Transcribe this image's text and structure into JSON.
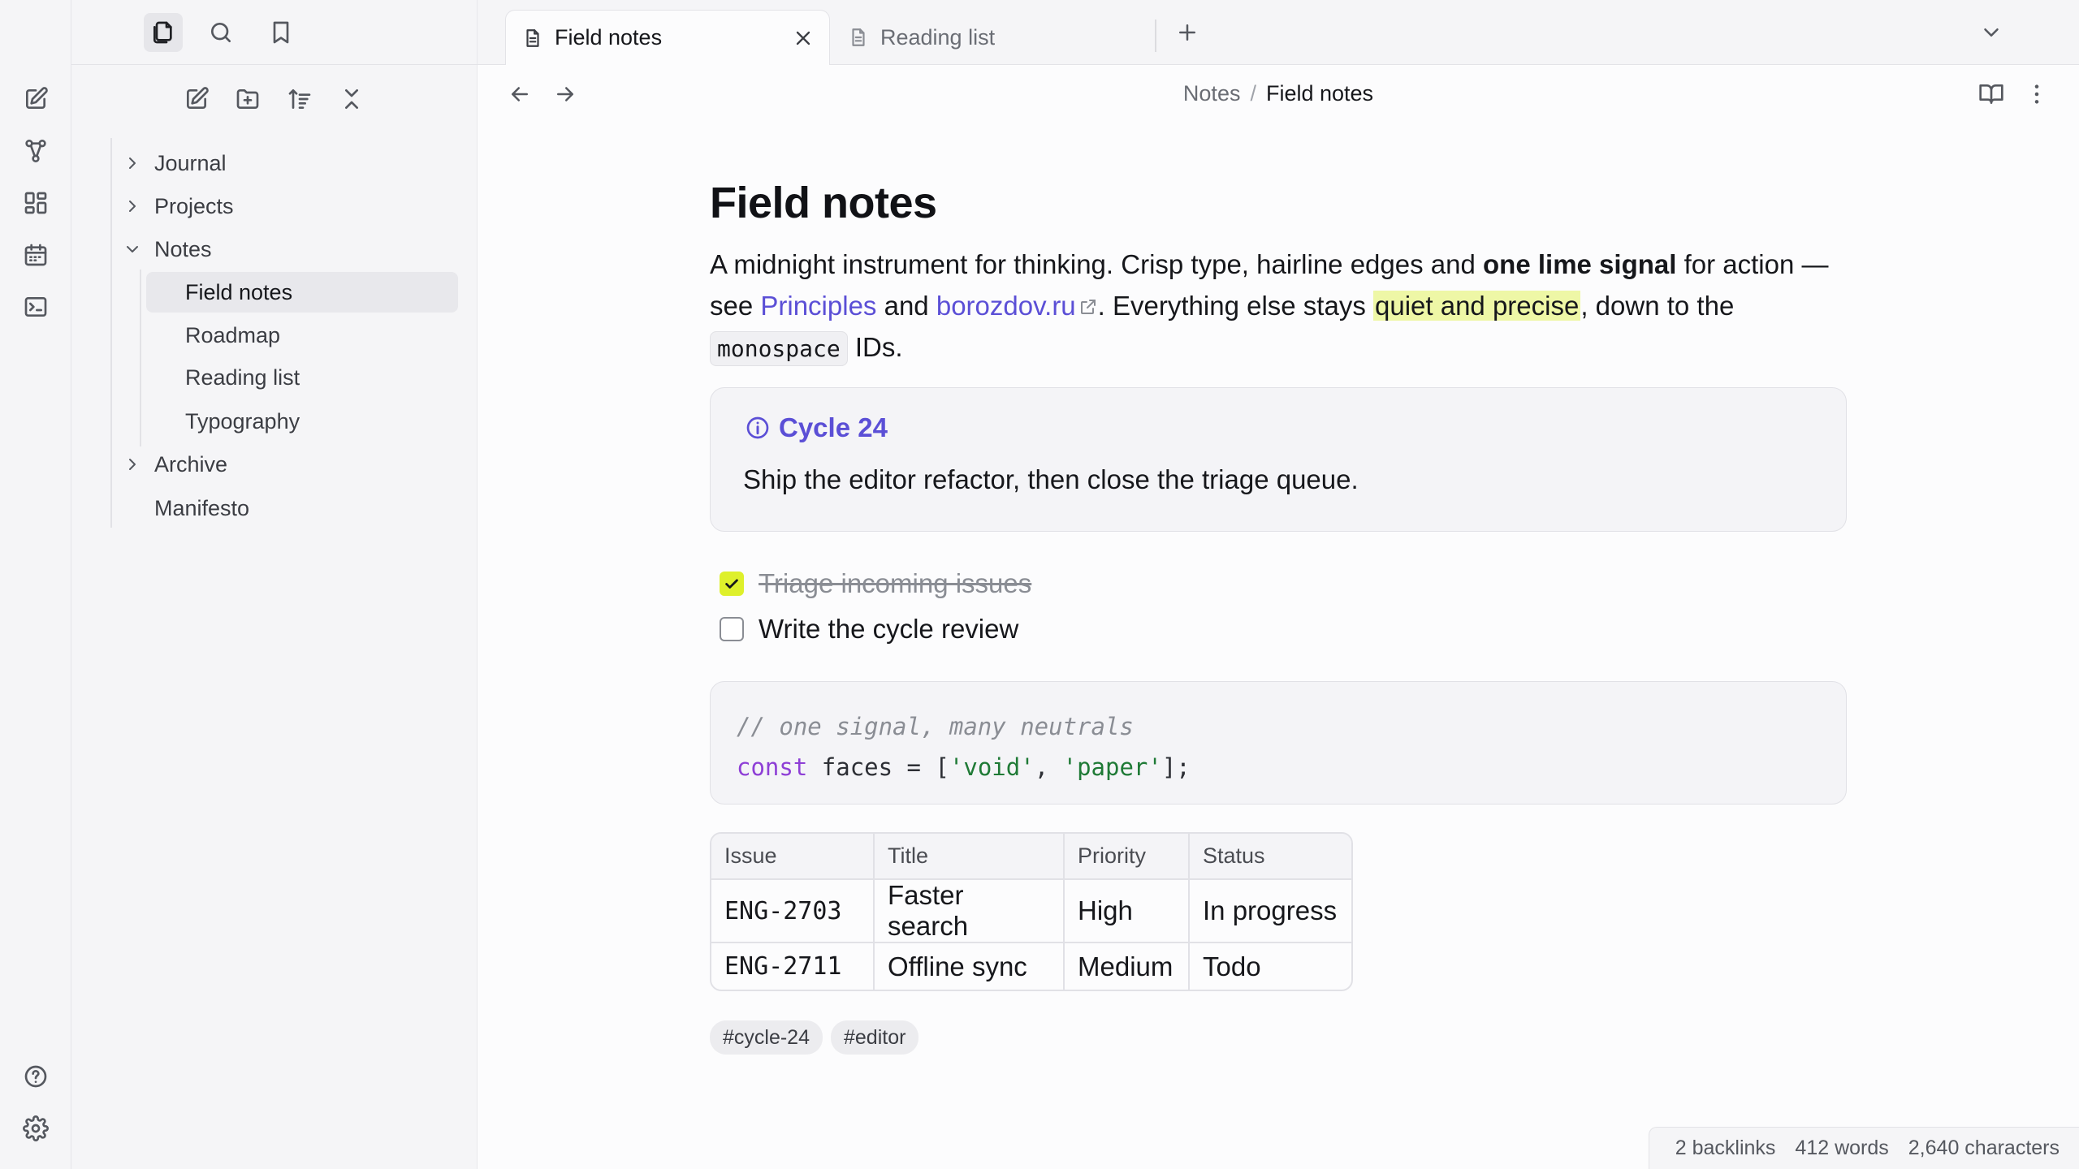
{
  "colors": {
    "accent": "#5b4fd6",
    "signal": "#def02b",
    "highlight": "#eef7a6"
  },
  "ribbon": {
    "top_icons": [
      "new-note-icon",
      "graph-icon",
      "canvas-icon",
      "calendar-icon",
      "terminal-icon"
    ],
    "bottom_icons": [
      "help-icon",
      "settings-icon"
    ]
  },
  "sidebar": {
    "top_icons": [
      "files-icon",
      "search-icon",
      "bookmark-icon"
    ],
    "tools": [
      "new-note-icon",
      "new-folder-icon",
      "sort-icon",
      "collapse-all-icon"
    ],
    "tree": {
      "journal": "Journal",
      "projects": "Projects",
      "notes": "Notes",
      "notes_children": [
        "Field notes",
        "Roadmap",
        "Reading list",
        "Typography"
      ],
      "archive": "Archive",
      "manifesto": "Manifesto"
    }
  },
  "tabs": [
    {
      "label": "Field notes",
      "active": true
    },
    {
      "label": "Reading list",
      "active": false
    }
  ],
  "breadcrumb": {
    "parent": "Notes",
    "separator": "/",
    "current": "Field notes"
  },
  "note": {
    "title": "Field notes",
    "para": {
      "t1": "A midnight instrument for thinking. Crisp type, hairline edges and ",
      "bold": "one lime signal",
      "t2": " for action — see ",
      "link1": "Principles",
      "t3": " and ",
      "link2": "borozdov.ru",
      "t4": ". Everything else stays ",
      "highlight": "quiet and precise",
      "t5": ", down to the ",
      "code": "monospace",
      "t6": " IDs."
    },
    "callout": {
      "title": "Cycle 24",
      "body": "Ship the editor refactor, then close the triage queue."
    },
    "tasks": [
      {
        "text": "Triage incoming issues",
        "done": true
      },
      {
        "text": "Write the cycle review",
        "done": false
      }
    ],
    "code": {
      "comment": "// one signal, many neutrals",
      "kw": "const",
      "mid": " faces = [",
      "s1": "'void'",
      "comma": ", ",
      "s2": "'paper'",
      "end": "];"
    },
    "table": {
      "headers": [
        "Issue",
        "Title",
        "Priority",
        "Status"
      ],
      "rows": [
        [
          "ENG-2703",
          "Faster search",
          "High",
          "In progress"
        ],
        [
          "ENG-2711",
          "Offline sync",
          "Medium",
          "Todo"
        ]
      ]
    },
    "tags": [
      "#cycle-24",
      "#editor"
    ]
  },
  "status": {
    "backlinks": "2 backlinks",
    "words": "412 words",
    "chars": "2,640 characters"
  }
}
